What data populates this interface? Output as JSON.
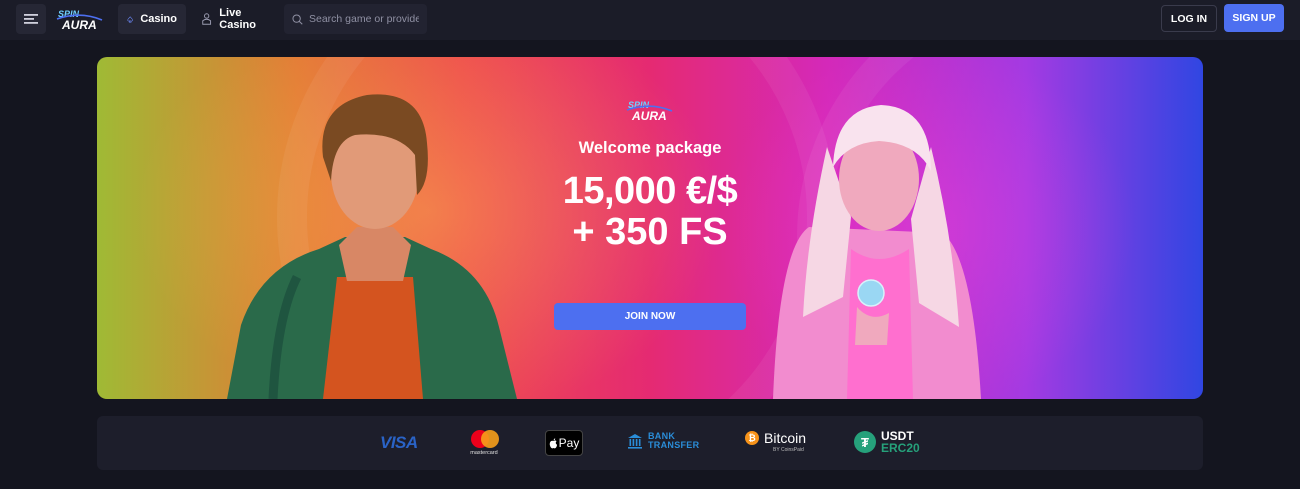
{
  "header": {
    "logo_text": "SPIN AURA",
    "nav": [
      {
        "label": "Casino",
        "icon": "spade-icon",
        "active": true
      },
      {
        "label": "Live Casino",
        "icon": "dealer-icon",
        "active": false
      }
    ],
    "search": {
      "placeholder": "Search game or provider"
    },
    "login_label": "LOG IN",
    "signup_label": "SIGN UP"
  },
  "banner": {
    "logo_text": "SPIN AURA",
    "subtitle": "Welcome package",
    "title_line1": "15,000 €/$",
    "title_line2": "+ 350 FS",
    "cta_label": "JOIN NOW"
  },
  "payments": {
    "visa": "VISA",
    "mastercard": "mastercard",
    "applepay": "Pay",
    "bank_line1": "BANK",
    "bank_line2": "TRANSFER",
    "bitcoin": "Bitcoin",
    "bitcoin_sub": "BY CoinsPaid",
    "usdt_line1": "USDT",
    "usdt_line2": "ERC20"
  },
  "colors": {
    "background": "#14151f",
    "header": "#1b1c28",
    "accent": "#4d6ff0",
    "payments_bar": "#1d1e2b"
  }
}
